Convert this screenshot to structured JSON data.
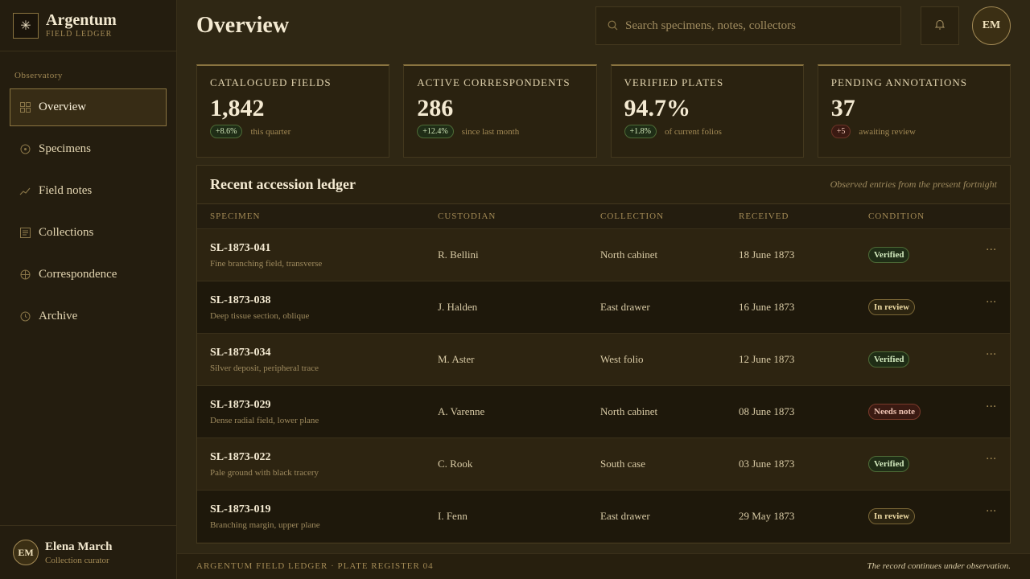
{
  "brand": {
    "name": "Argentum",
    "subtitle": "FIELD LEDGER",
    "mark_icon": "starburst-icon"
  },
  "sidebar": {
    "section": "Observatory",
    "items": [
      {
        "label": "Overview",
        "icon": "grid-icon",
        "active": true
      },
      {
        "label": "Specimens",
        "icon": "circle-dot-icon",
        "active": false
      },
      {
        "label": "Field notes",
        "icon": "trend-line-icon",
        "active": false
      },
      {
        "label": "Collections",
        "icon": "list-icon",
        "active": false
      },
      {
        "label": "Correspondence",
        "icon": "globe-icon",
        "active": false
      },
      {
        "label": "Archive",
        "icon": "clock-icon",
        "active": false
      }
    ]
  },
  "user": {
    "initials": "EM",
    "name": "Elena March",
    "role": "Collection curator"
  },
  "header": {
    "title": "Overview",
    "search_placeholder": "Search specimens, notes, collectors",
    "avatar_initials": "EM"
  },
  "stats": [
    {
      "label": "Catalogued fields",
      "value": "1,842",
      "delta": "+8.6%",
      "note": "this quarter",
      "trend": "up"
    },
    {
      "label": "Active correspondents",
      "value": "286",
      "delta": "+12.4%",
      "note": "since last month",
      "trend": "up"
    },
    {
      "label": "Verified plates",
      "value": "94.7%",
      "delta": "+1.8%",
      "note": "of current folios",
      "trend": "up"
    },
    {
      "label": "Pending annotations",
      "value": "37",
      "delta": "+5",
      "note": "awaiting review",
      "trend": "down"
    }
  ],
  "ledger": {
    "title": "Recent accession ledger",
    "subtitle": "Observed entries from the present fortnight",
    "columns": [
      "Specimen",
      "Custodian",
      "Collection",
      "Received",
      "Condition"
    ],
    "rows": [
      {
        "id": "SL-1873-041",
        "desc": "Fine branching field, transverse",
        "custodian": "R. Bellini",
        "collection": "North cabinet",
        "received": "18 June 1873",
        "condition": "Verified",
        "status": "verified"
      },
      {
        "id": "SL-1873-038",
        "desc": "Deep tissue section, oblique",
        "custodian": "J. Halden",
        "collection": "East drawer",
        "received": "16 June 1873",
        "condition": "In review",
        "status": "review"
      },
      {
        "id": "SL-1873-034",
        "desc": "Silver deposit, peripheral trace",
        "custodian": "M. Aster",
        "collection": "West folio",
        "received": "12 June 1873",
        "condition": "Verified",
        "status": "verified"
      },
      {
        "id": "SL-1873-029",
        "desc": "Dense radial field, lower plane",
        "custodian": "A. Varenne",
        "collection": "North cabinet",
        "received": "08 June 1873",
        "condition": "Needs note",
        "status": "note"
      },
      {
        "id": "SL-1873-022",
        "desc": "Pale ground with black tracery",
        "custodian": "C. Rook",
        "collection": "South case",
        "received": "03 June 1873",
        "condition": "Verified",
        "status": "verified"
      },
      {
        "id": "SL-1873-019",
        "desc": "Branching margin, upper plane",
        "custodian": "I. Fenn",
        "collection": "East drawer",
        "received": "29 May 1873",
        "condition": "In review",
        "status": "review"
      }
    ],
    "more_label": "···"
  },
  "footer": {
    "left": "ARGENTUM FIELD LEDGER · PLATE REGISTER 04",
    "right": "The record continues under observation."
  }
}
